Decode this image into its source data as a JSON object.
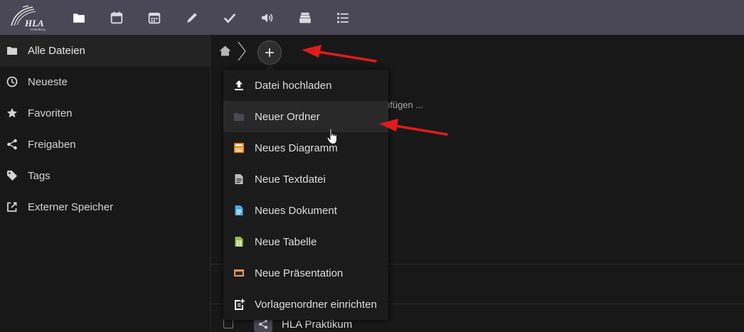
{
  "header": {
    "logo_icon": "hla-logo-icon",
    "apps": [
      {
        "icon": "folder-icon"
      },
      {
        "icon": "calendar-icon"
      },
      {
        "icon": "calendar-grid-icon"
      },
      {
        "icon": "pencil-icon"
      },
      {
        "icon": "checkmark-icon"
      },
      {
        "icon": "speaker-icon"
      },
      {
        "icon": "archive-icon"
      },
      {
        "icon": "list-icon"
      }
    ]
  },
  "sidebar": {
    "items": [
      {
        "label": "Alle Dateien",
        "icon": "folder-icon",
        "active": true
      },
      {
        "label": "Neueste",
        "icon": "clock-icon"
      },
      {
        "label": "Favoriten",
        "icon": "star-icon"
      },
      {
        "label": "Freigaben",
        "icon": "share-icon"
      },
      {
        "label": "Tags",
        "icon": "tag-icon"
      },
      {
        "label": "Externer Speicher",
        "icon": "external-link-icon"
      }
    ]
  },
  "main": {
    "breadcrumb_home_icon": "home-icon",
    "add_button_icon": "plus-icon",
    "hint_text": "ufügen ...",
    "files": [
      {
        "name": "HLA Praktikum",
        "icon": "shared-folder-icon"
      }
    ]
  },
  "new_menu": {
    "items": [
      {
        "label": "Datei hochladen",
        "icon": "upload-icon",
        "color": "#ffffff"
      },
      {
        "label": "Neuer Ordner",
        "icon": "folder-icon",
        "color": "#4a4857",
        "hovered": true
      },
      {
        "label": "Neues Diagramm",
        "icon": "diagram-icon",
        "color": "#f08705"
      },
      {
        "label": "Neue Textdatei",
        "icon": "text-file-icon",
        "color": "#bdbdbd"
      },
      {
        "label": "Neues Dokument",
        "icon": "document-icon",
        "color": "#49abea"
      },
      {
        "label": "Neue Tabelle",
        "icon": "spreadsheet-icon",
        "color": "#9abd4e"
      },
      {
        "label": "Neue Präsentation",
        "icon": "presentation-icon",
        "color": "#f0965f"
      },
      {
        "label": "Vorlagenordner einrichten",
        "icon": "template-folder-icon",
        "color": "#ffffff"
      }
    ]
  },
  "annotation_color": "#e01b1b"
}
